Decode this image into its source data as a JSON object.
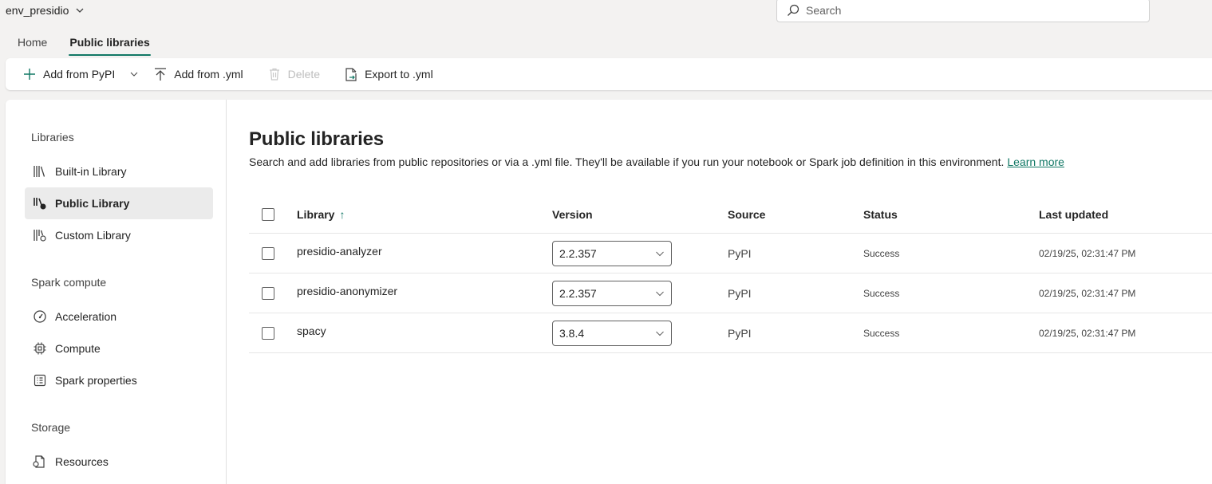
{
  "workspace": {
    "name": "env_presidio"
  },
  "search": {
    "placeholder": "Search"
  },
  "tabs": [
    {
      "label": "Home",
      "active": false
    },
    {
      "label": "Public libraries",
      "active": true
    }
  ],
  "toolbar": {
    "add_pypi": "Add from PyPI",
    "add_yml": "Add from .yml",
    "delete": "Delete",
    "export_yml": "Export to .yml"
  },
  "sidebar": {
    "sections": [
      {
        "title": "Libraries",
        "items": [
          {
            "label": "Built-in Library",
            "icon": "library-icon"
          },
          {
            "label": "Public Library",
            "icon": "public-library-icon",
            "active": true
          },
          {
            "label": "Custom Library",
            "icon": "custom-library-icon"
          }
        ]
      },
      {
        "title": "Spark compute",
        "items": [
          {
            "label": "Acceleration",
            "icon": "gauge-icon"
          },
          {
            "label": "Compute",
            "icon": "chip-icon"
          },
          {
            "label": "Spark properties",
            "icon": "properties-icon"
          }
        ]
      },
      {
        "title": "Storage",
        "items": [
          {
            "label": "Resources",
            "icon": "resources-icon"
          }
        ]
      }
    ]
  },
  "main": {
    "title": "Public libraries",
    "description": "Search and add libraries from public repositories or via a .yml file. They'll be available if you run your notebook or Spark job definition in this environment.",
    "learn_more": "Learn more",
    "columns": {
      "library": "Library",
      "version": "Version",
      "source": "Source",
      "status": "Status",
      "updated": "Last updated"
    },
    "rows": [
      {
        "library": "presidio-analyzer",
        "version": "2.2.357",
        "source": "PyPI",
        "status": "Success",
        "updated": "02/19/25, 02:31:47 PM"
      },
      {
        "library": "presidio-anonymizer",
        "version": "2.2.357",
        "source": "PyPI",
        "status": "Success",
        "updated": "02/19/25, 02:31:47 PM"
      },
      {
        "library": "spacy",
        "version": "3.8.4",
        "source": "PyPI",
        "status": "Success",
        "updated": "02/19/25, 02:31:47 PM"
      }
    ]
  },
  "colors": {
    "accent": "#117865",
    "background": "#f3f2f1"
  }
}
